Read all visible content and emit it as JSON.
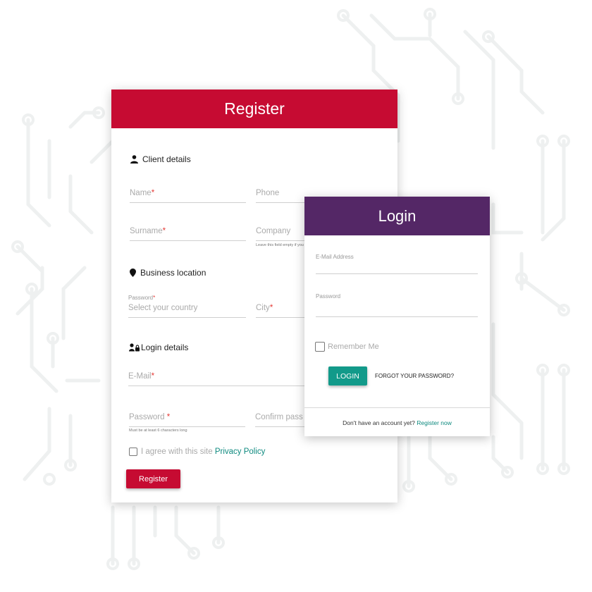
{
  "register": {
    "title": "Register",
    "sections": {
      "client": "Client details",
      "business": "Business location",
      "login": "Login details"
    },
    "fields": {
      "name": "Name",
      "phone": "Phone",
      "surname": "Surname",
      "company": "Company",
      "company_helper": "Leave this field empty if you",
      "country_label": "Password",
      "country_placeholder": "Select your country",
      "city": "City",
      "email": "E-Mail",
      "password": "Password",
      "password_helper": "Must be at least 6 characters long",
      "confirm_password": "Confirm pass",
      "required_mark": "*"
    },
    "agree_text": "I agree with this site",
    "privacy_link": "Privacy Policy",
    "submit": "Register"
  },
  "login": {
    "title": "Login",
    "email_label": "E-Mail Address",
    "password_label": "Password",
    "remember": "Remember Me",
    "submit": "LOGIN",
    "forgot": "FORGOT YOUR PASSWORD?",
    "no_account": "Don't have an account yet?",
    "register_link": "Register now"
  },
  "colors": {
    "register_accent": "#c60b32",
    "login_accent": "#542766",
    "login_button": "#129a8a",
    "link": "#0e8a7f",
    "required": "#e53935"
  },
  "icons": {
    "client": "person-icon",
    "business": "location-pin-icon",
    "login": "users-lock-icon"
  }
}
